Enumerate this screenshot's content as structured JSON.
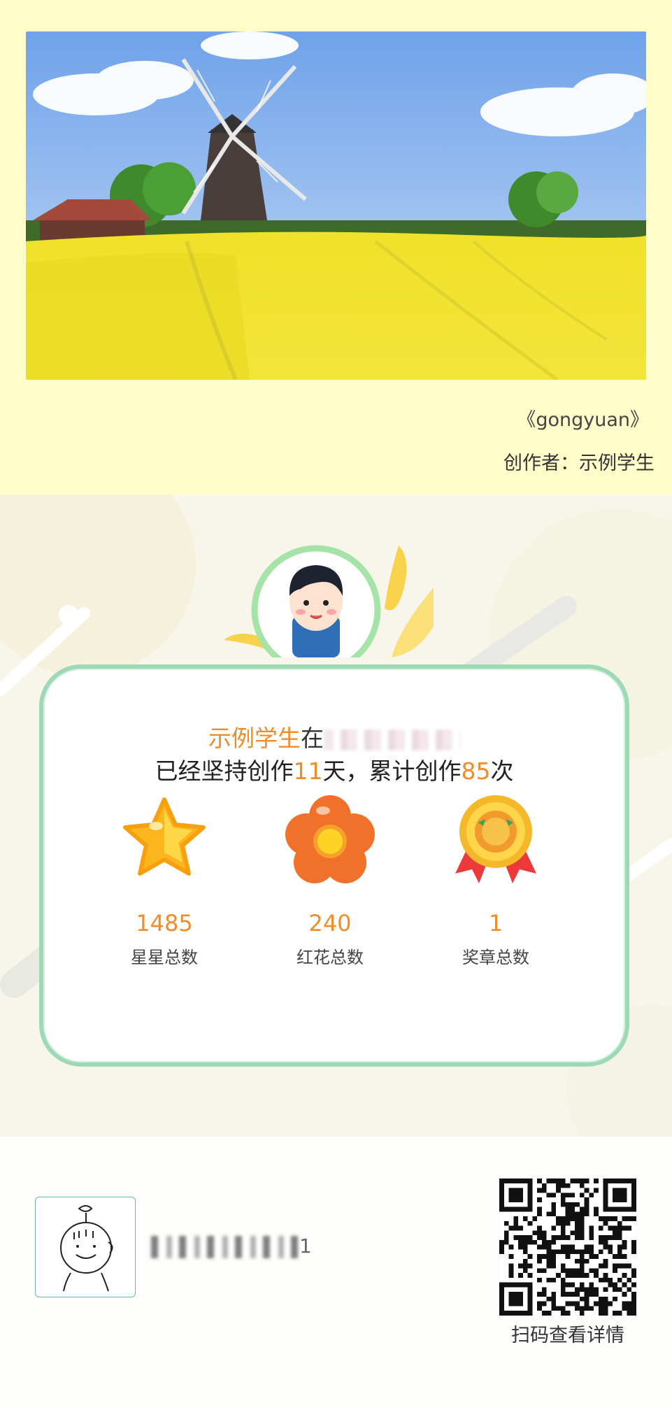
{
  "artwork": {
    "title": "《gongyuan》",
    "author_label": "创作者：示例学生"
  },
  "summary": {
    "student_name": "示例学生",
    "connector": "在",
    "line2_prefix": "已经坚持创作",
    "days": "11",
    "line2_mid": "天，累计创作",
    "count": "85",
    "line2_suffix": "次"
  },
  "stats": [
    {
      "value": "1485",
      "label": "星星总数",
      "icon": "star-icon"
    },
    {
      "value": "240",
      "label": "红花总数",
      "icon": "flower-icon"
    },
    {
      "value": "1",
      "label": "奖章总数",
      "icon": "medal-icon"
    }
  ],
  "footer": {
    "owner_tail": "1",
    "qr_label": "扫码查看详情"
  },
  "colors": {
    "accent": "#f08c2a",
    "card_border": "#9ed9b5",
    "top_bg": "#fffdc9"
  }
}
